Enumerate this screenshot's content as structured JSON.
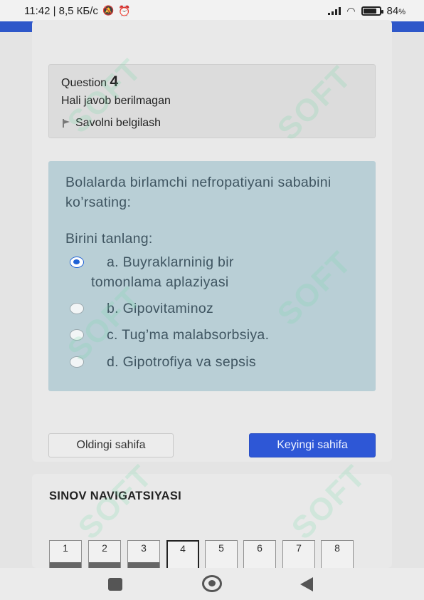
{
  "status_bar": {
    "time_info": "11:42 | 8,5 КБ/с",
    "battery": "84",
    "battery_unit": "%",
    "battery_level": 0.84
  },
  "question_info": {
    "label": "Question",
    "number": "4",
    "state": "Hali javob berilmagan",
    "flag_label": "Savolni belgilash"
  },
  "question": {
    "text": "Bolalarda birlamchi nefropatiyani sababini ko’rsating:",
    "prompt": "Birini tanlang:",
    "options": [
      {
        "line1": "a. Buyraklarninig bir",
        "line2": "tomonlama aplaziyasi",
        "selected": true
      },
      {
        "line1": "b. Gipovitaminoz",
        "selected": false
      },
      {
        "line1": "c. Tug’ma malabsorbsiya.",
        "selected": false
      },
      {
        "line1": "d. Gipotrofiya va sepsis",
        "selected": false
      }
    ]
  },
  "buttons": {
    "prev_label": "Oldingi sahifa",
    "next_label": "Keyingi sahifa"
  },
  "quiz_nav": {
    "title": "SINOV NAVIGATSIYASI",
    "items": [
      {
        "label": "1",
        "state": "answered"
      },
      {
        "label": "2",
        "state": "answered"
      },
      {
        "label": "3",
        "state": "answered"
      },
      {
        "label": "4",
        "state": "current"
      },
      {
        "label": "5",
        "state": "unanswered"
      },
      {
        "label": "6",
        "state": "unanswered"
      },
      {
        "label": "7",
        "state": "unanswered"
      },
      {
        "label": "8",
        "state": "unanswered"
      }
    ]
  },
  "watermark": {
    "text": "SOFT",
    "color": "#78dcaa"
  },
  "colors": {
    "brand": "#2e57c9",
    "primary_button": "#2e57d6",
    "question_bg": "#b9cfd6",
    "question_text": "#3f5561",
    "radio_selected": "#1f62d6"
  },
  "icons": {
    "flag": "flag-icon",
    "nav_recent": "square-icon",
    "nav_home": "circle-home-icon",
    "nav_back": "triangle-back-icon"
  }
}
